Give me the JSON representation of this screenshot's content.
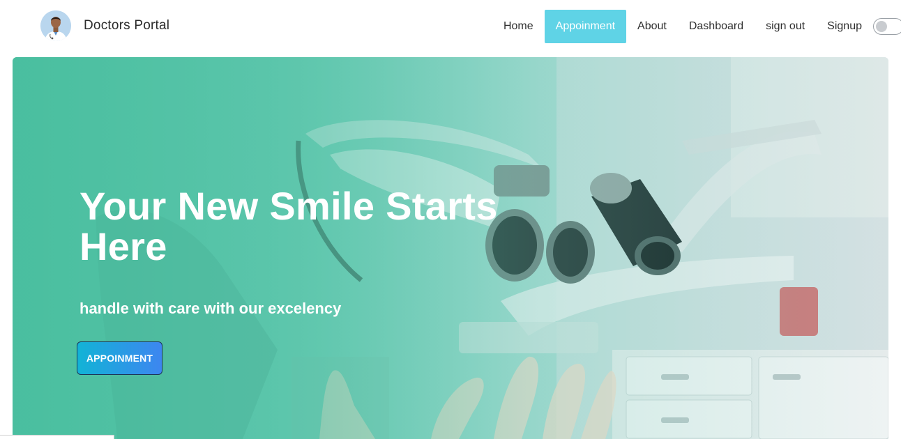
{
  "brand": {
    "name": "Doctors Portal",
    "avatar_icon": "doctor-avatar-icon"
  },
  "nav": {
    "items": [
      {
        "label": "Home",
        "active": false
      },
      {
        "label": "Appoinment",
        "active": true
      },
      {
        "label": "About",
        "active": false
      },
      {
        "label": "Dashboard",
        "active": false
      },
      {
        "label": "sign out",
        "active": false
      },
      {
        "label": "Signup",
        "active": false
      }
    ],
    "theme_toggle": {
      "on": false
    }
  },
  "hero": {
    "title": "Your New Smile Starts Here",
    "subtitle": "handle with care with our excelency",
    "button_label": "APPOINMENT"
  },
  "colors": {
    "accent": "#5fd3e6",
    "hero_overlay": "#4fc0a3",
    "button_start": "#12b3d6",
    "button_end": "#3d86f0"
  }
}
